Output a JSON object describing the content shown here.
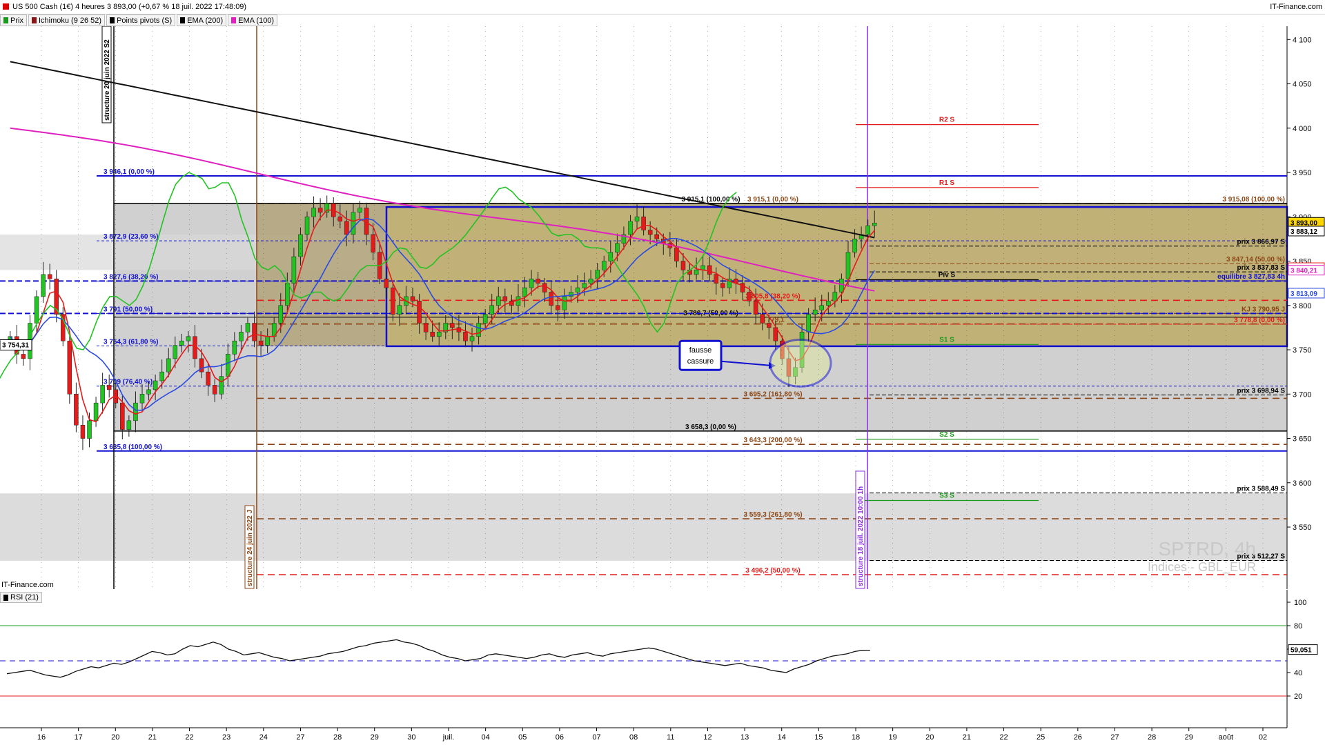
{
  "window": {
    "title": "US 500 Cash (1€) 4 heures 3 893,00 (+0,67 % 18 juil. 2022 17:48:09)",
    "site": "IT-Finance.com"
  },
  "legend": [
    {
      "label": "Prix",
      "color": "#1a9a1a"
    },
    {
      "label": "Ichimoku (9 26 52)",
      "color": "#8a1515"
    },
    {
      "label": "Points pivots (S)",
      "color": "#000000"
    },
    {
      "label": "EMA (200)",
      "color": "#000000"
    },
    {
      "label": "EMA (100)",
      "color": "#e020c0"
    }
  ],
  "colors": {
    "bull": "#22c322",
    "bear": "#e41b1b",
    "ema200": "#111111",
    "ema100": "#e020c0",
    "tenkan": "#e41b1b",
    "kijun": "#2a4be0",
    "chikou": "#22c322",
    "fibo": "#1010d0",
    "brown": "#8b4513"
  },
  "main_axis": {
    "ymin": 3480,
    "ymax": 4115,
    "ticks": [
      "4 100",
      "4 050",
      "4 000",
      "3 950",
      "3 900",
      "3 850",
      "3 800",
      "3 750",
      "3 700",
      "3 650",
      "3 600",
      "3 550"
    ]
  },
  "axis_labels": [
    {
      "text": "3 893,00",
      "value": 3893,
      "bg": "#ffd700",
      "fg": "#000"
    },
    {
      "text": "3 883,12",
      "value": 3883.12,
      "bg": "#ffffff",
      "fg": "#000"
    },
    {
      "text": "3 841,80",
      "value": 3841.8,
      "bg": "#ffffff",
      "fg": "#e41b1b"
    },
    {
      "text": "3 840,21",
      "value": 3839,
      "bg": "#ffffff",
      "fg": "#e020c0"
    },
    {
      "text": "3 813,09",
      "value": 3813.09,
      "bg": "#ffffff",
      "fg": "#2a4be0"
    }
  ],
  "date_axis": {
    "labels": [
      "16",
      "17",
      "20",
      "21",
      "22",
      "23",
      "24",
      "27",
      "28",
      "29",
      "30",
      "juil.",
      "04",
      "05",
      "06",
      "07",
      "08",
      "11",
      "12",
      "13",
      "14",
      "15",
      "18",
      "19",
      "20",
      "21",
      "22",
      "25",
      "26",
      "27",
      "28",
      "29",
      "août",
      "02"
    ]
  },
  "levels": [
    {
      "value": 3946.1,
      "label": "3 946,1 (0,00 %)",
      "color": "#1010d0",
      "side": "left"
    },
    {
      "value": 3872.9,
      "label": "3 872,9 (23,60 %)",
      "color": "#1010d0",
      "side": "left"
    },
    {
      "value": 3827.6,
      "label": "3 827,6 (38,20 %)",
      "color": "#1010d0",
      "side": "left"
    },
    {
      "value": 3791,
      "label": "3 791 (50,00 %)",
      "color": "#1010d0",
      "side": "left"
    },
    {
      "value": 3754.3,
      "label": "3 754,3 (61,80 %)",
      "color": "#1010d0",
      "side": "left"
    },
    {
      "value": 3709,
      "label": "3 709 (76,40 %)",
      "color": "#1010d0",
      "side": "left"
    },
    {
      "value": 3635.8,
      "label": "3 635,8 (100,00 %)",
      "color": "#1010d0",
      "side": "left"
    },
    {
      "value": 3915.1,
      "label": "3 915,1 (100,00 %)",
      "color": "#000",
      "side": "center"
    },
    {
      "value": 3915.1,
      "label": "3 915,1 (0,00 %)",
      "color": "#8b4513",
      "side": "mid"
    },
    {
      "value": 3915.08,
      "label": "3 915,08 (100,00 %)",
      "color": "#8b4513",
      "side": "right"
    },
    {
      "value": 3866.97,
      "label": "prix 3 866,97 S",
      "color": "#000",
      "side": "right"
    },
    {
      "value": 3847.14,
      "label": "3 847,14 (50,00 %)",
      "color": "#8b4513",
      "side": "right"
    },
    {
      "value": 3837.83,
      "label": "prix 3 837,83 S",
      "color": "#000",
      "side": "right"
    },
    {
      "value": 3827.83,
      "label": "equilibre 3 827,83 4h",
      "color": "#1010d0",
      "side": "right"
    },
    {
      "value": 3805.8,
      "label": "3 805,8 (38,20 %)",
      "color": "#e41b1b",
      "side": "mid"
    },
    {
      "value": 3790.95,
      "label": "KJ 3 790,95 J",
      "color": "#8b4513",
      "side": "right"
    },
    {
      "value": 3786.7,
      "label": "3 786,7 (50,00 %)",
      "color": "#000",
      "side": "center"
    },
    {
      "value": 3779.1,
      "label": "3 779,1",
      "color": "#8b4513",
      "side": "mid"
    },
    {
      "value": 3778.8,
      "label": "3 778,8 (0,00 %)",
      "color": "#e41b1b",
      "side": "right2"
    },
    {
      "value": 3698.94,
      "label": "prix 3 698,94 S",
      "color": "#000",
      "side": "right"
    },
    {
      "value": 3695.2,
      "label": "3 695,2 (161,80 %)",
      "color": "#8b4513",
      "side": "mid"
    },
    {
      "value": 3658.3,
      "label": "3 658,3 (0,00 %)",
      "color": "#000",
      "side": "center"
    },
    {
      "value": 3643.3,
      "label": "3 643,3 (200,00 %)",
      "color": "#8b4513",
      "side": "mid"
    },
    {
      "value": 3588.49,
      "label": "prix 3 588,49 S",
      "color": "#000",
      "side": "right"
    },
    {
      "value": 3559.3,
      "label": "3 559,3 (261,80 %)",
      "color": "#8b4513",
      "side": "mid"
    },
    {
      "value": 3512.27,
      "label": "prix 3 512,27 S",
      "color": "#000",
      "side": "right"
    },
    {
      "value": 3496.2,
      "label": "3 496,2 (50,00 %)",
      "color": "#e41b1b",
      "side": "mid"
    }
  ],
  "pivots": [
    {
      "value": 4004,
      "label": "R2 S",
      "color": "#e41b1b"
    },
    {
      "value": 3933,
      "label": "R1 S",
      "color": "#e41b1b"
    },
    {
      "value": 3829,
      "label": "Piv S",
      "color": "#000"
    },
    {
      "value": 3756,
      "label": "S1 S",
      "color": "#1a9a1a"
    },
    {
      "value": 3649,
      "label": "S2 S",
      "color": "#1a9a1a"
    },
    {
      "value": 3580,
      "label": "S3 S",
      "color": "#1a9a1a"
    }
  ],
  "vertical_markers": [
    {
      "label": "structure 20 juin 2022 S2",
      "color": "#000"
    },
    {
      "label": "structure 24 juin 2022 J",
      "color": "#8b4513"
    },
    {
      "label": "structure 18 juil. 2022 10:00 1h",
      "color": "#8a2be2"
    }
  ],
  "last_price_label": "3 754,31",
  "annotation": {
    "line1": "fausse",
    "line2": "cassure"
  },
  "watermark": {
    "line1": "SPTRD, 4h",
    "line2": "Indices - GBL_EUR"
  },
  "credit": "IT-Finance.com",
  "rsi": {
    "title": "RSI (21)",
    "ticks": [
      "100",
      "80",
      "60",
      "40",
      "20"
    ],
    "levels": [
      {
        "value": 80,
        "color": "#1a9a1a"
      },
      {
        "value": 20,
        "color": "#e41b1b"
      },
      {
        "value": 50,
        "color": "#1010d0"
      }
    ],
    "current_label": "59,051",
    "current": 59.051
  },
  "chart_data": {
    "type": "candlestick",
    "title": "US 500 Cash (1€) 4 heures",
    "ylim": [
      3480,
      4115
    ],
    "ohlc_closes": [
      3765,
      3745,
      3740,
      3780,
      3810,
      3835,
      3830,
      3790,
      3760,
      3700,
      3665,
      3650,
      3670,
      3690,
      3710,
      3705,
      3690,
      3660,
      3670,
      3690,
      3700,
      3705,
      3715,
      3725,
      3740,
      3755,
      3760,
      3765,
      3740,
      3725,
      3710,
      3700,
      3720,
      3745,
      3760,
      3770,
      3780,
      3760,
      3755,
      3765,
      3780,
      3800,
      3825,
      3855,
      3880,
      3900,
      3910,
      3905,
      3915,
      3900,
      3895,
      3880,
      3905,
      3910,
      3880,
      3860,
      3830,
      3820,
      3790,
      3800,
      3810,
      3805,
      3780,
      3770,
      3765,
      3770,
      3780,
      3775,
      3770,
      3760,
      3765,
      3780,
      3790,
      3800,
      3810,
      3805,
      3800,
      3810,
      3820,
      3830,
      3825,
      3815,
      3800,
      3795,
      3810,
      3815,
      3820,
      3825,
      3830,
      3840,
      3850,
      3860,
      3870,
      3880,
      3895,
      3900,
      3885,
      3880,
      3875,
      3870,
      3865,
      3850,
      3840,
      3835,
      3840,
      3845,
      3835,
      3825,
      3820,
      3830,
      3825,
      3815,
      3805,
      3790,
      3780,
      3775,
      3760,
      3740,
      3720,
      3730,
      3770,
      3790,
      3795,
      3800,
      3805,
      3815,
      3830,
      3860,
      3875,
      3880,
      3890,
      3893
    ],
    "rsi_values": [
      39,
      40,
      41,
      42,
      40,
      38,
      37,
      36,
      38,
      41,
      43,
      45,
      44,
      46,
      48,
      47,
      49,
      52,
      55,
      58,
      57,
      55,
      56,
      60,
      63,
      62,
      64,
      66,
      64,
      60,
      58,
      55,
      56,
      57,
      55,
      53,
      52,
      50,
      51,
      52,
      53,
      54,
      56,
      57,
      58,
      60,
      62,
      63,
      65,
      66,
      67,
      68,
      66,
      65,
      63,
      60,
      58,
      55,
      53,
      52,
      50,
      51,
      52,
      55,
      56,
      55,
      54,
      53,
      52,
      53,
      55,
      56,
      54,
      53,
      55,
      56,
      57,
      55,
      54,
      56,
      57,
      58,
      59,
      60,
      61,
      60,
      58,
      56,
      54,
      52,
      50,
      49,
      48,
      47,
      46,
      47,
      48,
      46,
      45,
      44,
      42,
      41,
      40,
      43,
      45,
      47,
      50,
      52,
      54,
      55,
      56,
      58,
      59,
      59.05
    ]
  }
}
